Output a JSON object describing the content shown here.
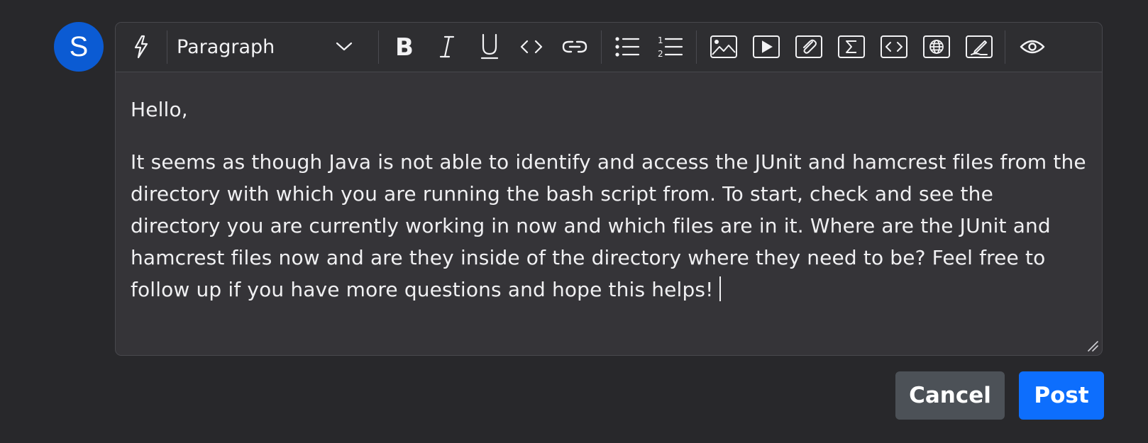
{
  "avatar": {
    "initial": "S",
    "color": "#0b5bd3"
  },
  "toolbar": {
    "block_format": {
      "selected": "Paragraph"
    },
    "buttons": [
      {
        "name": "ai-assist",
        "icon": "lightning-bolt-icon"
      },
      {
        "name": "bold",
        "icon": "bold-icon"
      },
      {
        "name": "italic",
        "icon": "italic-icon"
      },
      {
        "name": "underline",
        "icon": "underline-icon"
      },
      {
        "name": "inline-code",
        "icon": "code-icon"
      },
      {
        "name": "link",
        "icon": "link-icon"
      },
      {
        "name": "bulleted-list",
        "icon": "bulleted-list-icon"
      },
      {
        "name": "numbered-list",
        "icon": "numbered-list-icon"
      },
      {
        "name": "insert-image",
        "icon": "image-icon"
      },
      {
        "name": "insert-video",
        "icon": "video-icon"
      },
      {
        "name": "attach-file",
        "icon": "paperclip-icon"
      },
      {
        "name": "insert-math",
        "icon": "sigma-icon"
      },
      {
        "name": "code-block",
        "icon": "code-block-icon"
      },
      {
        "name": "insert-web-embed",
        "icon": "globe-icon"
      },
      {
        "name": "draw",
        "icon": "pen-icon"
      },
      {
        "name": "preview",
        "icon": "eye-icon"
      }
    ]
  },
  "content": {
    "paragraphs": [
      "Hello,",
      "It seems as though Java is not able to identify and access the JUnit and hamcrest files from the directory with which you are running the bash script from. To start, check and see the directory you are currently working in now and which files are in it. Where are the JUnit and hamcrest files now and are they inside of the directory where they need to be? Feel free to follow up if you have more questions and hope this helps!"
    ]
  },
  "actions": {
    "cancel_label": "Cancel",
    "post_label": "Post",
    "post_color": "#0d6efd"
  }
}
